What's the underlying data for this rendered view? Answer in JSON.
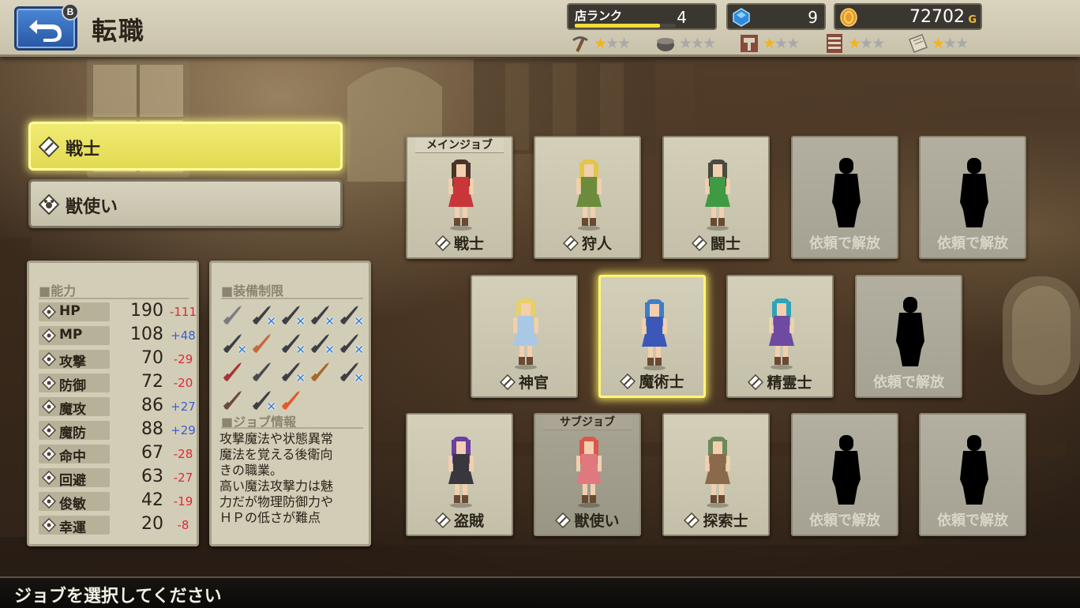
{
  "header": {
    "title": "転職",
    "back_badge": "B",
    "shop_rank_label": "店ランク",
    "shop_rank_value": "4",
    "shop_rank_progress": 0.84,
    "gems": "9",
    "gold": "72702",
    "gold_unit": "G",
    "category_ranks": [
      {
        "icon": "pickaxe-icon",
        "stars": 1,
        "max": 3
      },
      {
        "icon": "pot-icon",
        "stars": 0,
        "max": 3
      },
      {
        "icon": "hammer-icon",
        "stars": 1,
        "max": 3
      },
      {
        "icon": "shelf-icon",
        "stars": 1,
        "max": 3
      },
      {
        "icon": "scroll-icon",
        "stars": 1,
        "max": 3
      }
    ]
  },
  "job_list": [
    {
      "label": "戦士",
      "selected": true
    },
    {
      "label": "獣使い",
      "selected": false
    }
  ],
  "stats": {
    "header": "■能力",
    "rows": [
      {
        "name": "HP",
        "value": "190",
        "delta": "-111"
      },
      {
        "name": "MP",
        "value": "108",
        "delta": "+48"
      },
      {
        "name": "攻撃",
        "value": "70",
        "delta": "-29"
      },
      {
        "name": "防御",
        "value": "72",
        "delta": "-20"
      },
      {
        "name": "魔攻",
        "value": "86",
        "delta": "+27"
      },
      {
        "name": "魔防",
        "value": "88",
        "delta": "+29"
      },
      {
        "name": "命中",
        "value": "67",
        "delta": "-28"
      },
      {
        "name": "回避",
        "value": "63",
        "delta": "-27"
      },
      {
        "name": "俊敏",
        "value": "42",
        "delta": "-19"
      },
      {
        "name": "幸運",
        "value": "20",
        "delta": "-8"
      }
    ]
  },
  "equipment": {
    "header": "■装備制限",
    "items": [
      {
        "icon": "sword-icon",
        "blocked": false
      },
      {
        "icon": "greatsword-icon",
        "blocked": true
      },
      {
        "icon": "axe-icon",
        "blocked": true
      },
      {
        "icon": "spear-icon",
        "blocked": true
      },
      {
        "icon": "gun-icon",
        "blocked": true
      },
      {
        "icon": "claw-icon",
        "blocked": true
      },
      {
        "icon": "staff-icon",
        "blocked": false
      },
      {
        "icon": "pickaxe-icon",
        "blocked": true
      },
      {
        "icon": "whip-icon",
        "blocked": true
      },
      {
        "icon": "bow-icon",
        "blocked": true
      },
      {
        "icon": "shield-icon",
        "blocked": false
      },
      {
        "icon": "hat-icon",
        "blocked": false
      },
      {
        "icon": "helmet-icon",
        "blocked": true
      },
      {
        "icon": "bag-icon",
        "blocked": false
      },
      {
        "icon": "armor-icon",
        "blocked": true
      },
      {
        "icon": "boots-icon",
        "blocked": false
      },
      {
        "icon": "robe-icon",
        "blocked": true
      },
      {
        "icon": "ring-icon",
        "blocked": false
      }
    ]
  },
  "job_info": {
    "header": "■ジョブ情報",
    "text": "攻撃魔法や状態異常\n魔法を覚える後衛向\nきの職業。\n高い魔法攻撃力は魅\n力だが物理防御力や\nＨＰの低さが難点"
  },
  "job_cards": [
    {
      "name": "戦士",
      "tag": "メインジョブ",
      "locked": false,
      "selected": false,
      "sub": false,
      "hair": "#4a3328",
      "outfit": "#c8363a",
      "skin": "#f2cfae",
      "icon": "sword-icon"
    },
    {
      "name": "狩人",
      "tag": "",
      "locked": false,
      "selected": false,
      "sub": false,
      "hair": "#e2c54a",
      "outfit": "#6c8c3c",
      "skin": "#f2cfae",
      "icon": "bow-icon"
    },
    {
      "name": "闘士",
      "tag": "",
      "locked": false,
      "selected": false,
      "sub": false,
      "hair": "#4a4a3e",
      "outfit": "#3f9a44",
      "skin": "#f2cfae",
      "icon": "fist-icon"
    },
    {
      "name": "依頼で解放",
      "tag": "",
      "locked": true
    },
    {
      "name": "依頼で解放",
      "tag": "",
      "locked": true
    },
    {
      "name": "神官",
      "tag": "",
      "locked": false,
      "selected": false,
      "sub": false,
      "hair": "#e8cf6a",
      "outfit": "#a9c8e6",
      "skin": "#f2cfae",
      "icon": "cross-icon"
    },
    {
      "name": "魔術士",
      "tag": "",
      "locked": false,
      "selected": true,
      "sub": false,
      "hair": "#3e7ec8",
      "outfit": "#3b57b8",
      "skin": "#f2cfae",
      "icon": "wand-icon"
    },
    {
      "name": "精霊士",
      "tag": "",
      "locked": false,
      "selected": false,
      "sub": false,
      "hair": "#2ea4b8",
      "outfit": "#6e4aa0",
      "skin": "#f2cfae",
      "icon": "spirit-icon"
    },
    {
      "name": "依頼で解放",
      "tag": "",
      "locked": true
    },
    {
      "name": "盗賊",
      "tag": "",
      "locked": false,
      "selected": false,
      "sub": false,
      "hair": "#6a3f9e",
      "outfit": "#3a3640",
      "skin": "#f2cfae",
      "icon": "dagger-icon"
    },
    {
      "name": "獣使い",
      "tag": "サブジョブ",
      "locked": false,
      "selected": false,
      "sub": true,
      "hair": "#d8584e",
      "outfit": "#e07880",
      "skin": "#f2cfae",
      "icon": "beast-icon"
    },
    {
      "name": "探索士",
      "tag": "",
      "locked": false,
      "selected": false,
      "sub": false,
      "hair": "#6f8a58",
      "outfit": "#8a6a4a",
      "skin": "#f2cfae",
      "icon": "explore-icon"
    },
    {
      "name": "依頼で解放",
      "tag": "",
      "locked": true
    },
    {
      "name": "依頼で解放",
      "tag": "",
      "locked": true
    }
  ],
  "status_message": "ジョブを選択してください",
  "colors": {
    "selected_yellow": "#f1eb74",
    "positive": "#3a5fd6",
    "negative": "#e0283a",
    "star_on": "#f0b420",
    "star_off": "#a9a9a9"
  }
}
